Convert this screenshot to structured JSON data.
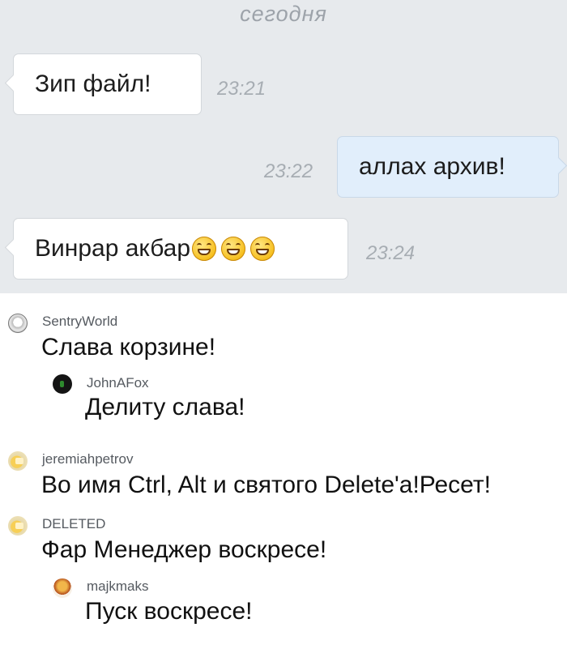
{
  "chat": {
    "date_separator": "сегодня",
    "messages": [
      {
        "direction": "incoming",
        "text": "Зип файл!",
        "time": "23:21"
      },
      {
        "direction": "outgoing",
        "text": "аллах архив!",
        "time": "23:22"
      },
      {
        "direction": "incoming",
        "text": "Винрар акбар",
        "time": "23:24",
        "emojis": [
          "grinning-face-emoji",
          "grinning-face-emoji",
          "grinning-face-emoji"
        ]
      }
    ]
  },
  "comments": [
    {
      "user": "SentryWorld",
      "avatar": "helmet-avatar-icon",
      "text": "Слава корзине!",
      "level": 0
    },
    {
      "user": "JohnAFox",
      "avatar": "dark-avatar-icon",
      "text": "Делиту слава!",
      "level": 1
    },
    {
      "user": "jeremiahpetrov",
      "avatar": "cheese-avatar-icon",
      "text": "Во имя Ctrl, Alt и святого Delete'a!Ресет!",
      "level": 0
    },
    {
      "user": "DELETED",
      "avatar": "cheese-avatar-icon",
      "text": "Фар Менеджер воскресе!",
      "level": 0
    },
    {
      "user": "majkmaks",
      "avatar": "cupcake-avatar-icon",
      "text": "Пуск воскресе!",
      "level": 1
    }
  ]
}
